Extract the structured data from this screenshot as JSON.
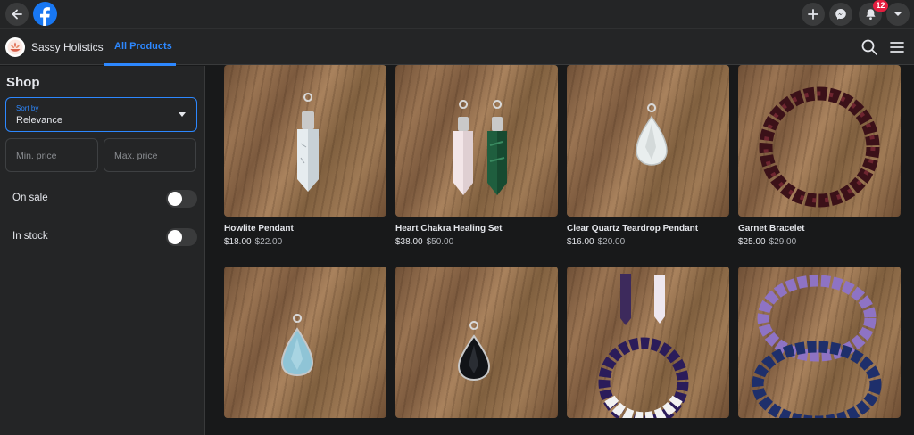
{
  "topbar": {
    "notification_count": "12",
    "icons": [
      "back-arrow-icon",
      "facebook-logo-icon",
      "plus-icon",
      "messenger-icon",
      "bell-icon",
      "account-caret-icon"
    ]
  },
  "page": {
    "name": "Sassy Holistics",
    "tab_label": "All Products",
    "accent_color": "#2d88ff"
  },
  "sidebar": {
    "title": "Shop",
    "sort": {
      "label": "Sort by",
      "value": "Relevance"
    },
    "min_price_placeholder": "Min. price",
    "max_price_placeholder": "Max. price",
    "on_sale": {
      "label": "On sale",
      "enabled": false
    },
    "in_stock": {
      "label": "In stock",
      "enabled": false
    }
  },
  "products": [
    {
      "name": "Howlite Pendant",
      "price": "$18.00",
      "old_price": "$22.00"
    },
    {
      "name": "Heart Chakra Healing Set",
      "price": "$38.00",
      "old_price": "$50.00"
    },
    {
      "name": "Clear Quartz Teardrop Pendant",
      "price": "$16.00",
      "old_price": "$20.00"
    },
    {
      "name": "Garnet Bracelet",
      "price": "$25.00",
      "old_price": "$29.00"
    },
    {
      "name": "",
      "price": "",
      "old_price": ""
    },
    {
      "name": "",
      "price": "",
      "old_price": ""
    },
    {
      "name": "",
      "price": "",
      "old_price": ""
    },
    {
      "name": "",
      "price": "",
      "old_price": ""
    }
  ]
}
